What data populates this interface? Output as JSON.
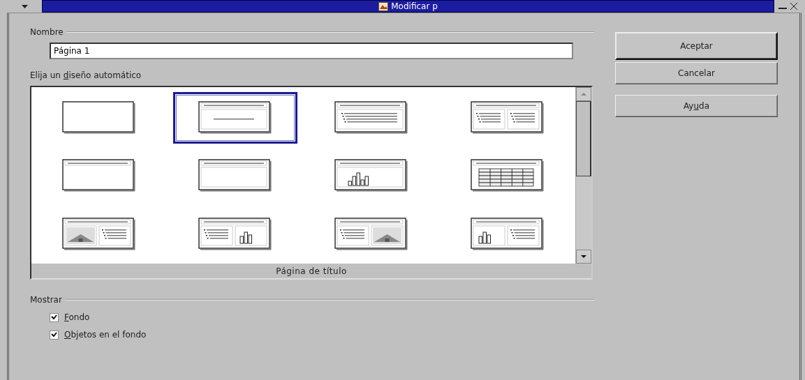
{
  "window": {
    "title": "Modificar p"
  },
  "name_group": {
    "label": "Nombre",
    "value": "Página 1"
  },
  "layout_group": {
    "label_before": "Elija un ",
    "access_key": "d",
    "label_after": "iseño automático",
    "layouts": [
      {
        "kind": "blank",
        "selected": false
      },
      {
        "kind": "title",
        "selected": true
      },
      {
        "kind": "title-list",
        "selected": false
      },
      {
        "kind": "title-two-lists",
        "selected": false
      },
      {
        "kind": "title-only",
        "selected": false
      },
      {
        "kind": "title-content",
        "selected": false
      },
      {
        "kind": "title-chart",
        "selected": false
      },
      {
        "kind": "title-table",
        "selected": false
      },
      {
        "kind": "picture-list",
        "selected": false
      },
      {
        "kind": "list-chart",
        "selected": false
      },
      {
        "kind": "list-picture",
        "selected": false
      },
      {
        "kind": "chart-list",
        "selected": false
      }
    ],
    "caption": "Página de título"
  },
  "show_group": {
    "label": "Mostrar",
    "options": [
      {
        "access_key": "F",
        "label_after": "ondo",
        "checked": true
      },
      {
        "access_key": "O",
        "label_after": "bjetos en el fondo",
        "checked": true
      }
    ]
  },
  "buttons": [
    {
      "label_before": "Aceptar",
      "default": true
    },
    {
      "label_before": "Cancelar",
      "default": false
    },
    {
      "label_before": "Ay",
      "access_key": "u",
      "label_after": "da",
      "default": false
    }
  ]
}
